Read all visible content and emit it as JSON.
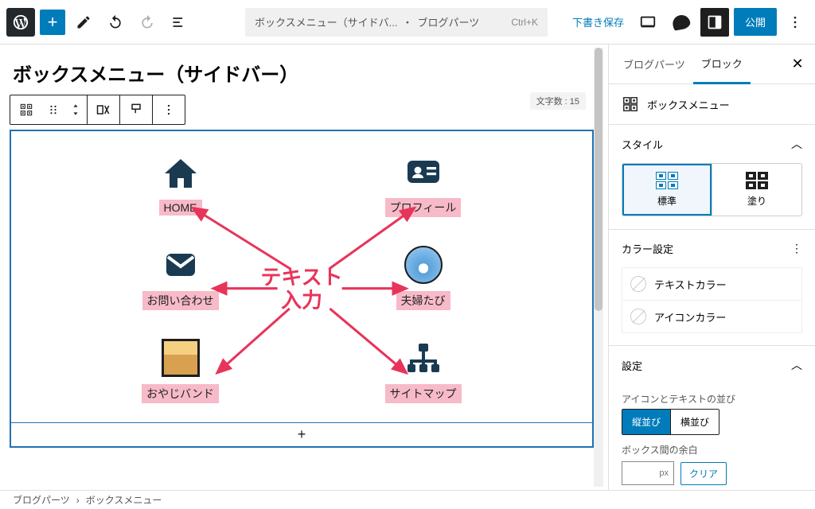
{
  "topbar": {
    "doc_title": "ボックスメニュー（サイドバ...",
    "doc_sep": "・",
    "doc_context": "ブログパーツ",
    "shortcut": "Ctrl+K",
    "draft_save": "下書き保存",
    "publish": "公開"
  },
  "page": {
    "title": "ボックスメニュー（サイドバー）",
    "charcount_label": "文字数  :  15"
  },
  "annotation": {
    "line1": "テキスト",
    "line2": "入力"
  },
  "cells": [
    {
      "label": "HOME"
    },
    {
      "label": "プロフィール"
    },
    {
      "label": "お問い合わせ"
    },
    {
      "label": "夫婦たび"
    },
    {
      "label": "おやじバンド"
    },
    {
      "label": "サイトマップ"
    }
  ],
  "sidebar": {
    "tabs": {
      "parts": "ブログパーツ",
      "block": "ブロック"
    },
    "block_name": "ボックスメニュー",
    "panels": {
      "style": "スタイル",
      "color": "カラー設定",
      "settings": "設定"
    },
    "style_opts": {
      "std": "標準",
      "fill": "塗り"
    },
    "colors": {
      "text": "テキストカラー",
      "icon": "アイコンカラー"
    },
    "settings": {
      "layout_label": "アイコンとテキストの並び",
      "vertical": "縦並び",
      "horizontal": "横並び",
      "gap_label": "ボックス間の余白",
      "unit": "px",
      "clear": "クリア"
    }
  },
  "breadcrumb": {
    "a": "ブログパーツ",
    "b": "ボックスメニュー"
  }
}
